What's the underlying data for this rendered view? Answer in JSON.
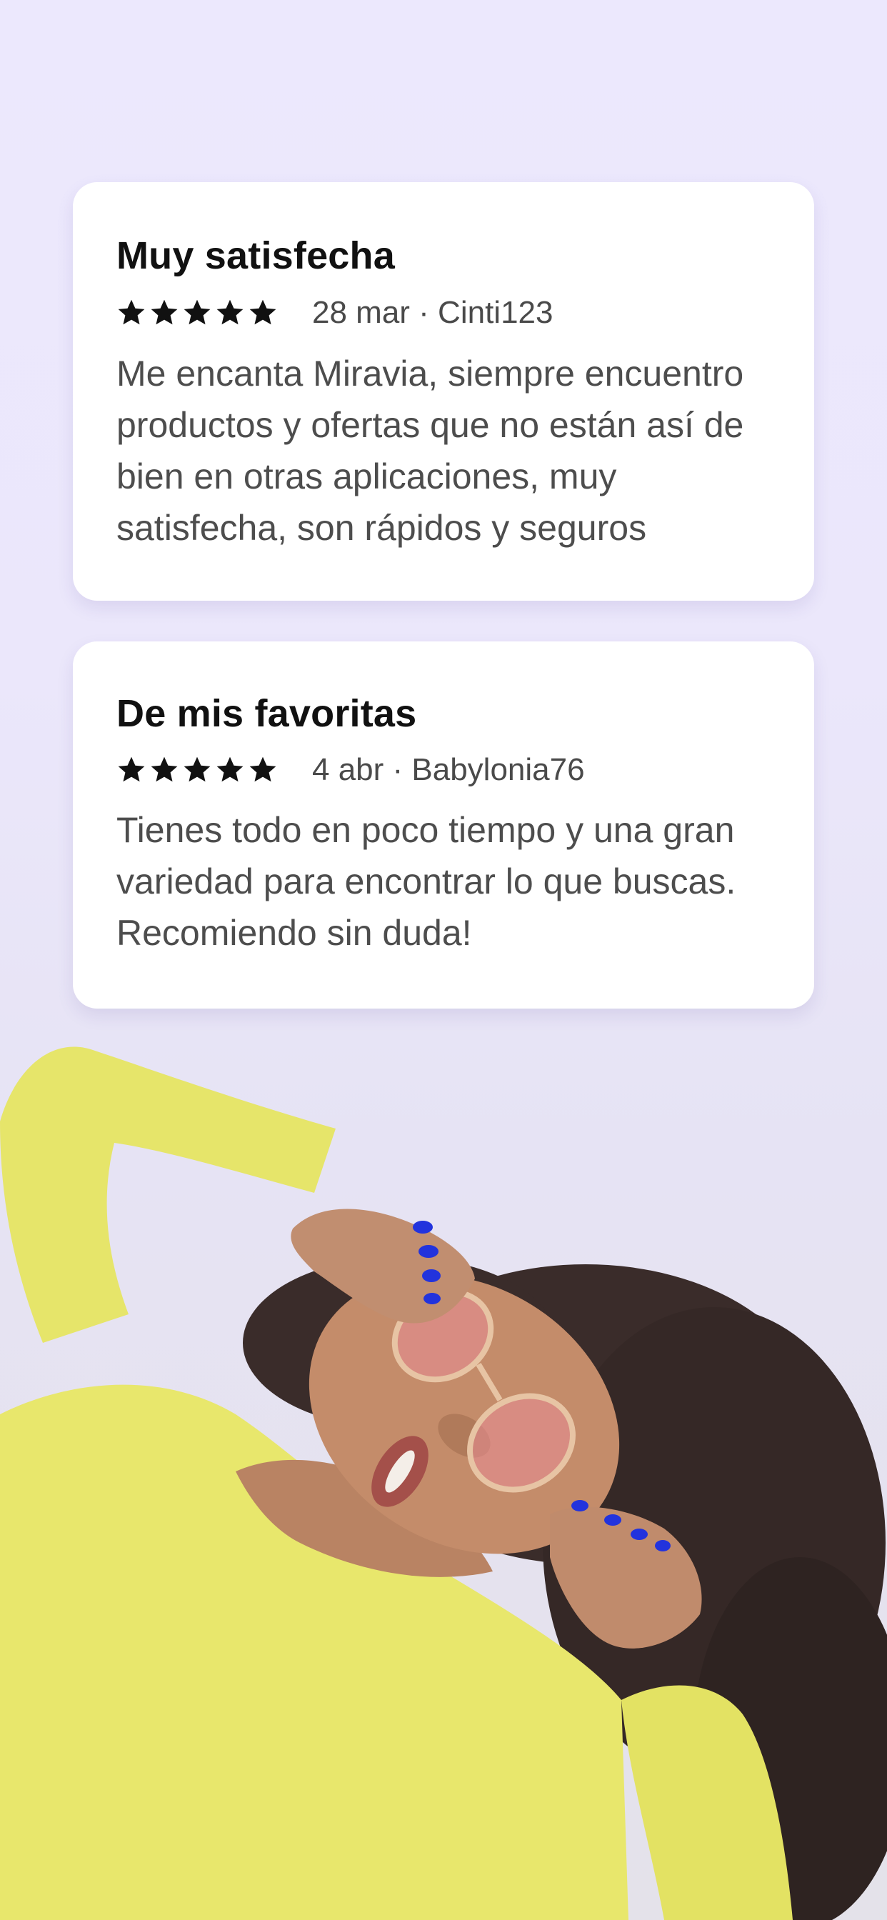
{
  "reviews": [
    {
      "title": "Muy satisfecha",
      "rating": 5,
      "meta": "28 mar · Cinti123",
      "body": "Me encanta Miravia, siempre encuentro productos y ofertas que no están así de bien en otras aplicaciones, muy satisfecha, son rápidos y seguros"
    },
    {
      "title": "De mis favoritas",
      "rating": 5,
      "meta": "4 abr · Babylonia76",
      "body": "Tienes todo en poco tiempo y una gran variedad para encontrar lo que buscas. Recomiendo sin duda!"
    }
  ],
  "colors": {
    "background": "#ece8fd",
    "card": "#ffffff",
    "shirt": "#e8e86a",
    "nails": "#2233dd"
  }
}
